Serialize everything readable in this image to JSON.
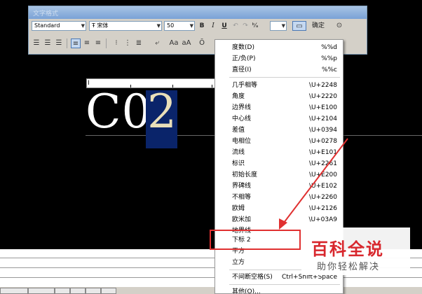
{
  "toolbar": {
    "title": "文字格式",
    "style_value": "Standard",
    "font_value": "宋体",
    "size_value": "50",
    "bold_label": "B",
    "italic_label": "I",
    "underline_label": "U",
    "ok_label": "确定",
    "font_prefix": "Ŧ"
  },
  "editor": {
    "text_normal": "C0",
    "text_selected": "2"
  },
  "menu": {
    "items": [
      {
        "label": "度数(D)",
        "code": "%%d"
      },
      {
        "label": "正/负(P)",
        "code": "%%p"
      },
      {
        "label": "直径(I)",
        "code": "%%c"
      },
      {
        "label": "几乎相等",
        "code": "\\U+2248"
      },
      {
        "label": "角度",
        "code": "\\U+2220"
      },
      {
        "label": "边界线",
        "code": "\\U+E100"
      },
      {
        "label": "中心线",
        "code": "\\U+2104"
      },
      {
        "label": "差值",
        "code": "\\U+0394"
      },
      {
        "label": "电相位",
        "code": "\\U+0278"
      },
      {
        "label": "流线",
        "code": "\\U+E101"
      },
      {
        "label": "标识",
        "code": "\\U+2261"
      },
      {
        "label": "初始长度",
        "code": "\\U+E200"
      },
      {
        "label": "界碑线",
        "code": "\\U+E102"
      },
      {
        "label": "不相等",
        "code": "\\U+2260"
      },
      {
        "label": "欧姆",
        "code": "\\U+2126"
      },
      {
        "label": "欧米加",
        "code": "\\U+03A9"
      },
      {
        "label": "地界线",
        "code": ""
      },
      {
        "label": "下标 2",
        "code": ""
      },
      {
        "label": "平方",
        "code": ""
      },
      {
        "label": "立方",
        "code": ""
      },
      {
        "label": "不间断空格(S)",
        "code": "Ctrl+Shift+Space"
      },
      {
        "label": "其他(O)...",
        "code": ""
      }
    ]
  },
  "watermark": {
    "title": "百科全说",
    "subtitle": "助你轻松解决"
  },
  "colors": {
    "highlight": "#e03030",
    "selection": "#0a246a",
    "watermark_red": "#d8272d"
  }
}
